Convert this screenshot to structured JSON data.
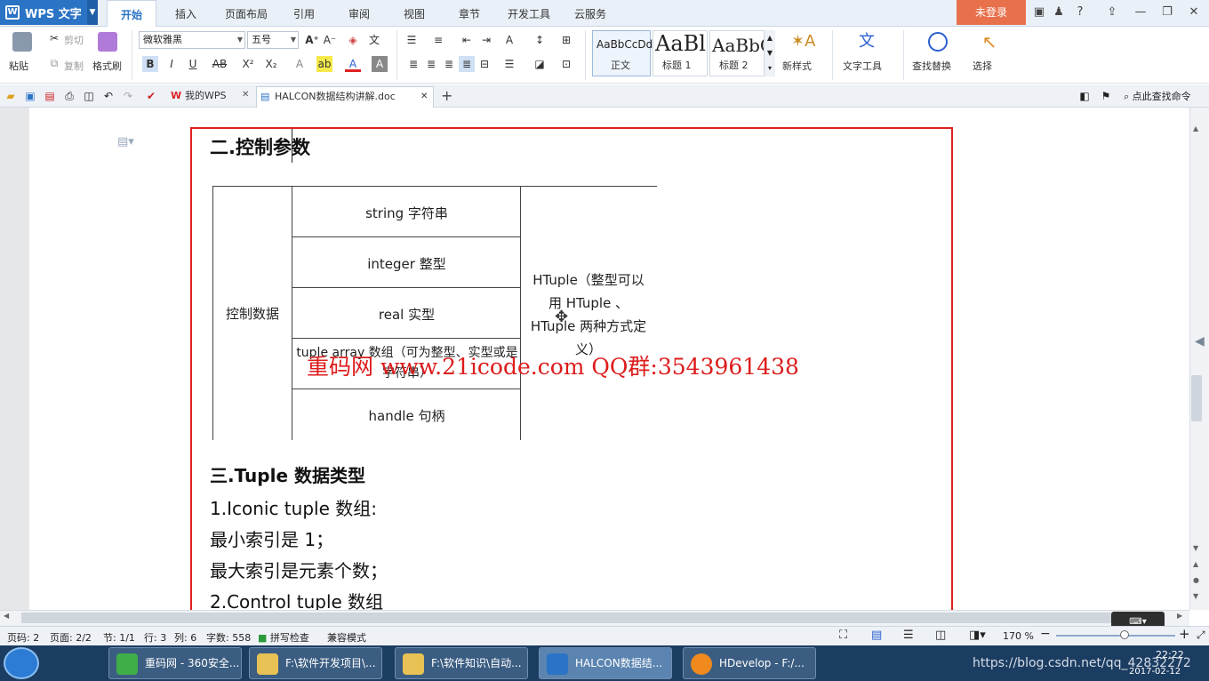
{
  "app": {
    "name": "WPS 文字",
    "logo": "W"
  },
  "menu": [
    "开始",
    "插入",
    "页面布局",
    "引用",
    "审阅",
    "视图",
    "章节",
    "开发工具",
    "云服务"
  ],
  "login": "未登录",
  "ribbon": {
    "paste": "粘贴",
    "cut": "剪切",
    "copy": "复制",
    "format_painter": "格式刷",
    "font_name": "微软雅黑",
    "font_size": "五号",
    "styles": [
      {
        "preview": "AaBbCcDd",
        "name": "正文"
      },
      {
        "preview": "AaBl",
        "name": "标题 1"
      },
      {
        "preview": "AaBbC",
        "name": "标题 2"
      }
    ],
    "new_style": "新样式",
    "text_tools": "文字工具",
    "find_replace": "查找替换",
    "select": "选择"
  },
  "tabs": {
    "mywps": "我的WPS",
    "doc": "HALCON数据结构讲解.doc",
    "search": "点此查找命令"
  },
  "document": {
    "heading2": "二.控制参数",
    "table": {
      "left": "控制数据",
      "rows": [
        "string  字符串",
        "integer  整型",
        "real  实型",
        "tuple array  数组（可为整型、实型或是字符串）",
        "handle  句柄"
      ],
      "right": "HTuple（整型可以用 HTuple 、HTuple 两种方式定义）"
    },
    "watermark": "重码网 www.21icode.com   QQ群:3543961438",
    "heading3": "三.Tuple 数据类型",
    "lines": [
      "1.Iconic tuple 数组:",
      "最小索引是 1；",
      "最大索引是元素个数；",
      "2.Control tuple 数组"
    ]
  },
  "status": {
    "page_no": "页码: 2",
    "pages": "页面: 2/2",
    "section": "节: 1/1",
    "row": "行: 3",
    "col": "列: 6",
    "words": "字数: 558",
    "spell": "拼写检查",
    "mode": "兼容模式",
    "zoom": "170 %"
  },
  "taskbar": [
    {
      "label": "重码网 - 360安全...",
      "icon": "browser-icon",
      "color": "#3fae49"
    },
    {
      "label": "F:\\软件开发项目\\...",
      "icon": "folder-icon",
      "color": "#e8c254"
    },
    {
      "label": "F:\\软件知识\\自动...",
      "icon": "folder-icon",
      "color": "#e8c254"
    },
    {
      "label": "HALCON数据结...",
      "icon": "wps-icon",
      "color": "#2b73c4"
    },
    {
      "label": "HDevelop - F:/...",
      "icon": "hdevelop-icon",
      "color": "#f08a1e"
    }
  ],
  "tray": {
    "time": "22:22",
    "date": "2017-02-12",
    "url": "https://blog.csdn.net/qq_42832272"
  }
}
